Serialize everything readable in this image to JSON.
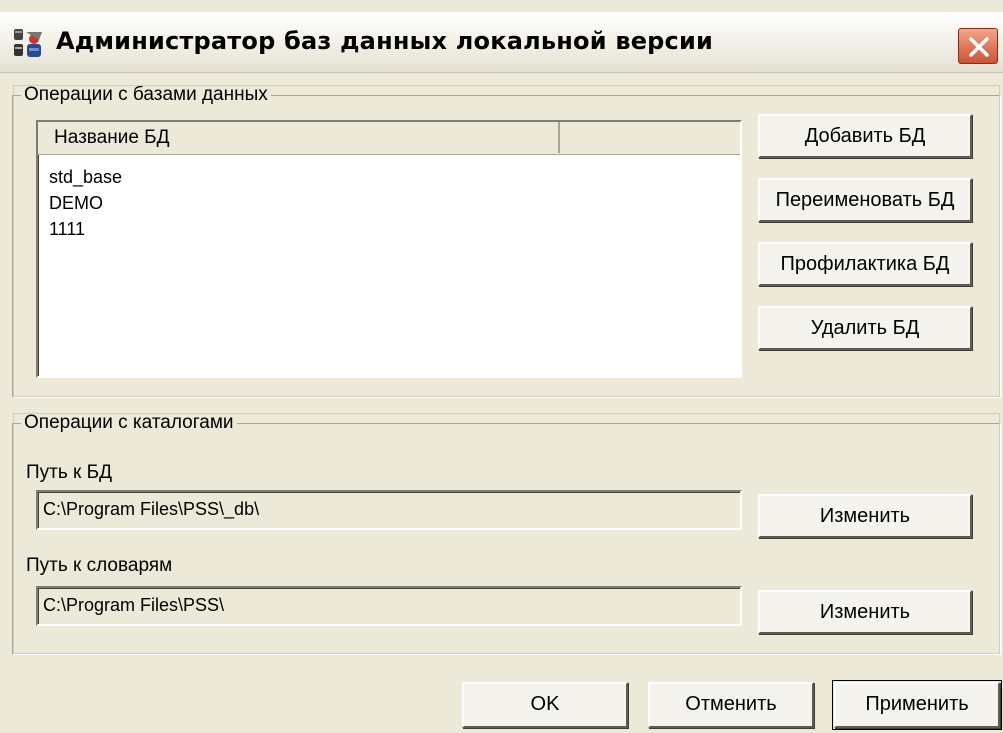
{
  "window": {
    "title": "Администратор баз данных локальной версии",
    "app_icon": "database-admin-icon",
    "close_icon": "close-icon"
  },
  "db_operations": {
    "legend": "Операции с базами данных",
    "list": {
      "columns": [
        "Название БД",
        ""
      ],
      "items": [
        "std_base",
        "DEMO",
        "1111"
      ]
    },
    "buttons": {
      "add": "Добавить БД",
      "rename": "Переименовать БД",
      "maintenance": "Профилактика БД",
      "delete": "Удалить БД"
    }
  },
  "catalog_operations": {
    "legend": "Операции с каталогами",
    "db_path_label": "Путь к БД",
    "db_path_value": "C:\\Program Files\\PSS\\_db\\",
    "db_path_change": "Изменить",
    "dict_path_label": "Путь к словарям",
    "dict_path_value": "C:\\Program Files\\PSS\\",
    "dict_path_change": "Изменить"
  },
  "dialog_buttons": {
    "ok": "OK",
    "cancel": "Отменить",
    "apply": "Применить"
  },
  "colors": {
    "face": "#ece9d8",
    "close_button": "#e07a5c"
  }
}
